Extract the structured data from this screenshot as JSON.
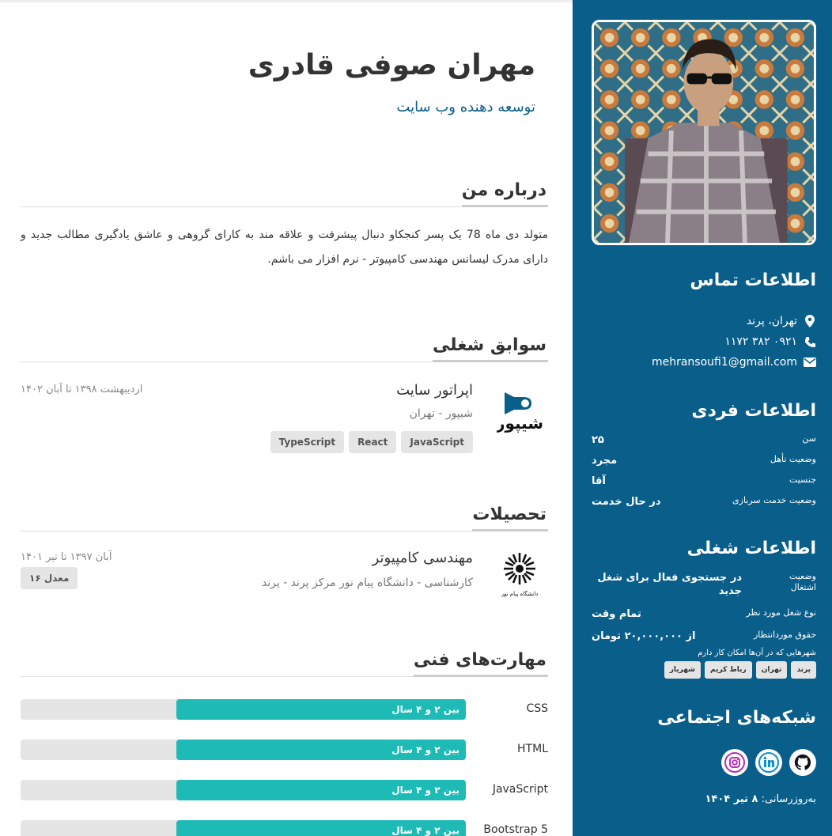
{
  "profile": {
    "name": "مهران صوفی قادری",
    "role": "توسعه دهنده وب سایت"
  },
  "about": {
    "heading": "درباره من",
    "text": "متولد دی ماه 78 یک پسر کنجکاو دنبال پیشرفت و علاقه مند به کارای گروهی و عاشق یادگیری مطالب جدید و دارای مدرک لیسانس مهندسی کامپیوتر - نرم افزار می باشم."
  },
  "experience": {
    "heading": "سوابق شغلی",
    "items": [
      {
        "title": "اپراتور سایت",
        "company": "شیپور - تهران",
        "date": "اردیبهشت ۱۳۹۸ تا آبان ۱۴۰۲",
        "logo_text": "شیپور",
        "tags": [
          "JavaScript",
          "React",
          "TypeScript"
        ]
      }
    ]
  },
  "education": {
    "heading": "تحصیلات",
    "items": [
      {
        "title": "مهندسی کامپیوتر",
        "detail": "کارشناسی - دانشگاه پیام نور مرکز پرند - پرند",
        "date": "آبان ۱۳۹۷ تا تیر ۱۴۰۱",
        "gpa": "معدل ۱۶",
        "logo_text": "دانشگاه پیام نور"
      }
    ]
  },
  "skills": {
    "heading": "مهارت‌های فنی",
    "items": [
      {
        "name": "CSS",
        "level": "بین ۲ و ۴ سال",
        "fill": 0.65
      },
      {
        "name": "HTML",
        "level": "بین ۲ و ۴ سال",
        "fill": 0.65
      },
      {
        "name": "JavaScript",
        "level": "بین ۲ و ۴ سال",
        "fill": 0.65
      },
      {
        "name": "Bootstrap 5",
        "level": "بین ۲ و ۴ سال",
        "fill": 0.65
      }
    ]
  },
  "sidebar": {
    "contact": {
      "heading": "اطلاعات تماس",
      "location": "تهران، پرند",
      "phone": "۰۹۲۱ ۳۸۲ ۱۱۷۲",
      "email": "mehransoufi1@gmail.com"
    },
    "personal": {
      "heading": "اطلاعات فردی",
      "rows": [
        {
          "key": "سن",
          "value": "۲۵"
        },
        {
          "key": "وضعیت تأهل",
          "value": "مجرد"
        },
        {
          "key": "جنسیت",
          "value": "آقا"
        },
        {
          "key": "وضعیت خدمت سربازی",
          "value": "در حال خدمت"
        }
      ]
    },
    "job": {
      "heading": "اطلاعات شغلی",
      "status_key": "وضعیت اشتغال",
      "status_value": "در جستجوی فعال برای شغل جدید",
      "type_key": "نوع شغل مورد نظر",
      "type_value": "تمام وقت",
      "salary_key": "حقوق موردانتظار",
      "salary_value": "از ۲۰,۰۰۰,۰۰۰ تومان",
      "cities_label": "شهرهایی که در آن‌ها امکان کار دارم",
      "cities": [
        "پرند",
        "تهران",
        "رباط کریم",
        "شهریار"
      ]
    },
    "social": {
      "heading": "شبکه‌های اجتماعی",
      "icons": [
        "github-icon",
        "linkedin-icon",
        "instagram-icon"
      ]
    },
    "updated_label": "به‌روزرسانی:",
    "updated_value": "۸ تیر ۱۴۰۴"
  },
  "colors": {
    "sidebar_bg": "#0a5e8a",
    "accent": "#1ebab6",
    "chip_bg": "#e5e5e5"
  }
}
